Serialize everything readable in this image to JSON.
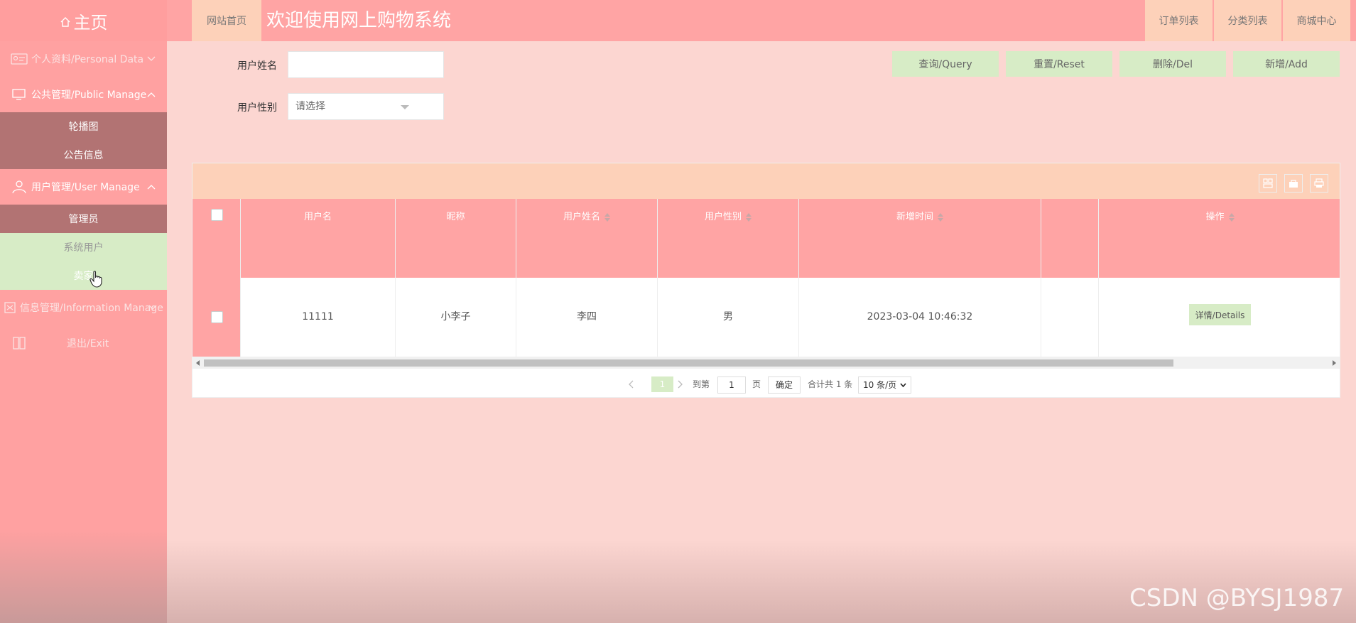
{
  "sidebar": {
    "home_label": "主页",
    "items": [
      {
        "label": "个人资料/Personal Data"
      },
      {
        "label": "公共管理/Public Manage",
        "children": [
          "轮播图",
          "公告信息"
        ]
      },
      {
        "label": "用户管理/User Manage",
        "children": [
          "管理员",
          "系统用户",
          "卖家"
        ]
      },
      {
        "label": "信息管理/Information Manage"
      },
      {
        "label": "退出/Exit"
      }
    ]
  },
  "header": {
    "home_link": "网站首页",
    "title": "欢迎使用网上购物系统",
    "right_links": [
      "订单列表",
      "分类列表",
      "商城中心"
    ]
  },
  "search": {
    "name_label": "用户姓名",
    "name_value": "",
    "gender_label": "用户性别",
    "gender_value": "请选择"
  },
  "actions": {
    "query": "查询/Query",
    "reset": "重置/Reset",
    "delete": "删除/Del",
    "add": "新增/Add"
  },
  "table": {
    "columns": [
      "用户名",
      "昵称",
      "用户姓名",
      "用户性别",
      "新增时间",
      "",
      "操作"
    ],
    "rows": [
      {
        "username": "11111",
        "nickname": "小李子",
        "realname": "李四",
        "gender": "男",
        "created": "2023-03-04 10:46:32",
        "extra": "",
        "action": "详情/Details"
      }
    ]
  },
  "pager": {
    "current_page": "1",
    "goto_label": "到第",
    "goto_value": "1",
    "page_unit": "页",
    "confirm": "确定",
    "total": "合计共 1 条",
    "page_size": "10 条/页"
  },
  "watermark": "CSDN @BYSJ1987",
  "colors": {
    "header_pink": "#ffa4a4",
    "background": "#fcd6d1",
    "peach": "#fdd1b9",
    "green": "#d7ecc6",
    "submenu_dark": "#b27373"
  }
}
